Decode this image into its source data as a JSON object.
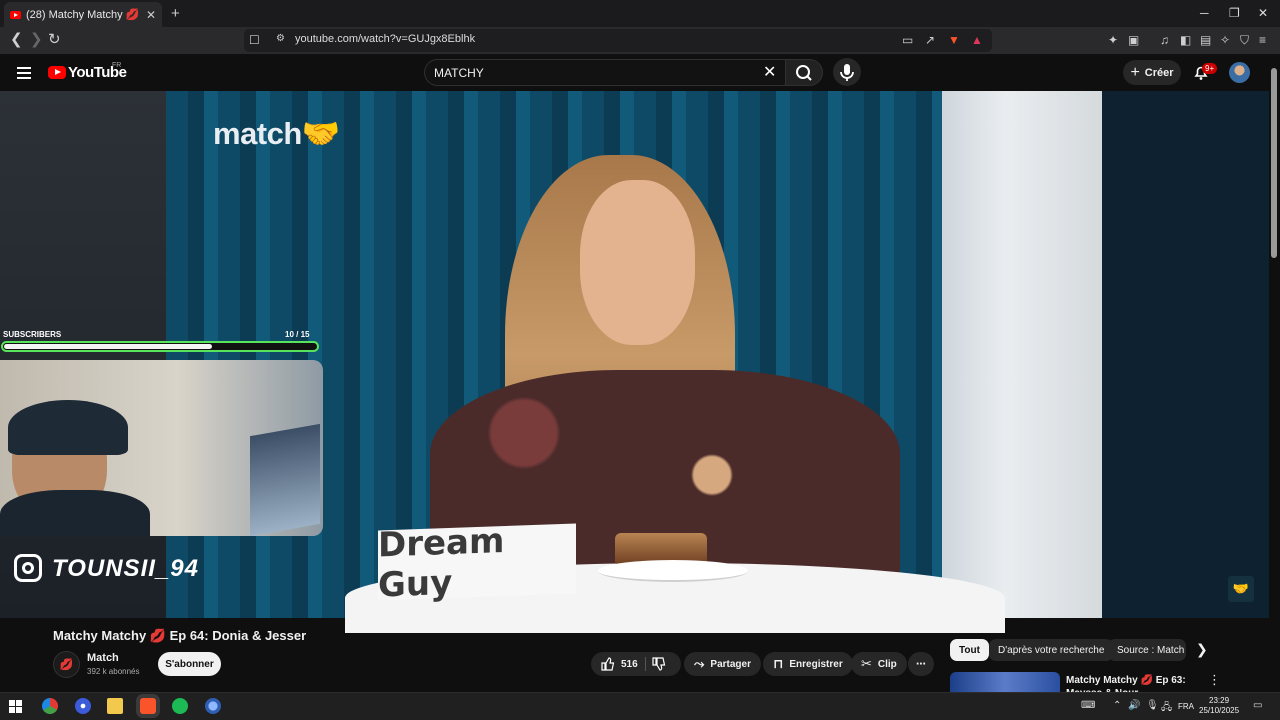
{
  "browser": {
    "tab_title": "(28) Matchy Matchy 💋 Ep 64: Donia & Jesser",
    "tab_close": "✕",
    "new_tab": "+",
    "window_controls": {
      "minimize": "─",
      "restore": "❐",
      "close": "✕"
    },
    "url": "youtube.com/watch?v=GUJgx8Eblhk",
    "back": "❮",
    "forward": "❯",
    "reload": "↻"
  },
  "youtube": {
    "logo_text": "YouTube",
    "country_code": "FR",
    "search_value": "MATCHY",
    "clear_icon": "✕",
    "create_label": "Créer",
    "create_icon": "+",
    "notif_count": "9+"
  },
  "video": {
    "brand_logo": "match🤝",
    "name_card": "Dream Guy",
    "watermark": "🤝"
  },
  "stream_overlay": {
    "subs_label": "SUBSCRIBERS",
    "subs_count": "10  / 15",
    "subs_progress": 0.667,
    "progress_color": "#58e35c",
    "instagram_handle": "TOUNSII_94"
  },
  "watch": {
    "title": "Matchy Matchy 💋 Ep 64: Donia & Jesser",
    "channel_name": "Match",
    "channel_subs": "392 k abonnés",
    "subscribe_label": "S'abonner",
    "likes": "516",
    "share_label": "Partager",
    "save_label": "Enregistrer",
    "clip_label": "Clip",
    "more_icon": "⋯"
  },
  "recommend": {
    "chips": [
      "Tout",
      "D'après votre recherche",
      "Source : Match"
    ],
    "next_icon": "❯",
    "first_title": "Matchy Matchy 💋 Ep 63: Mayssa & Nour"
  },
  "taskbar": {
    "language": "FRA",
    "time": "23:29",
    "date": "25/10/2025"
  }
}
